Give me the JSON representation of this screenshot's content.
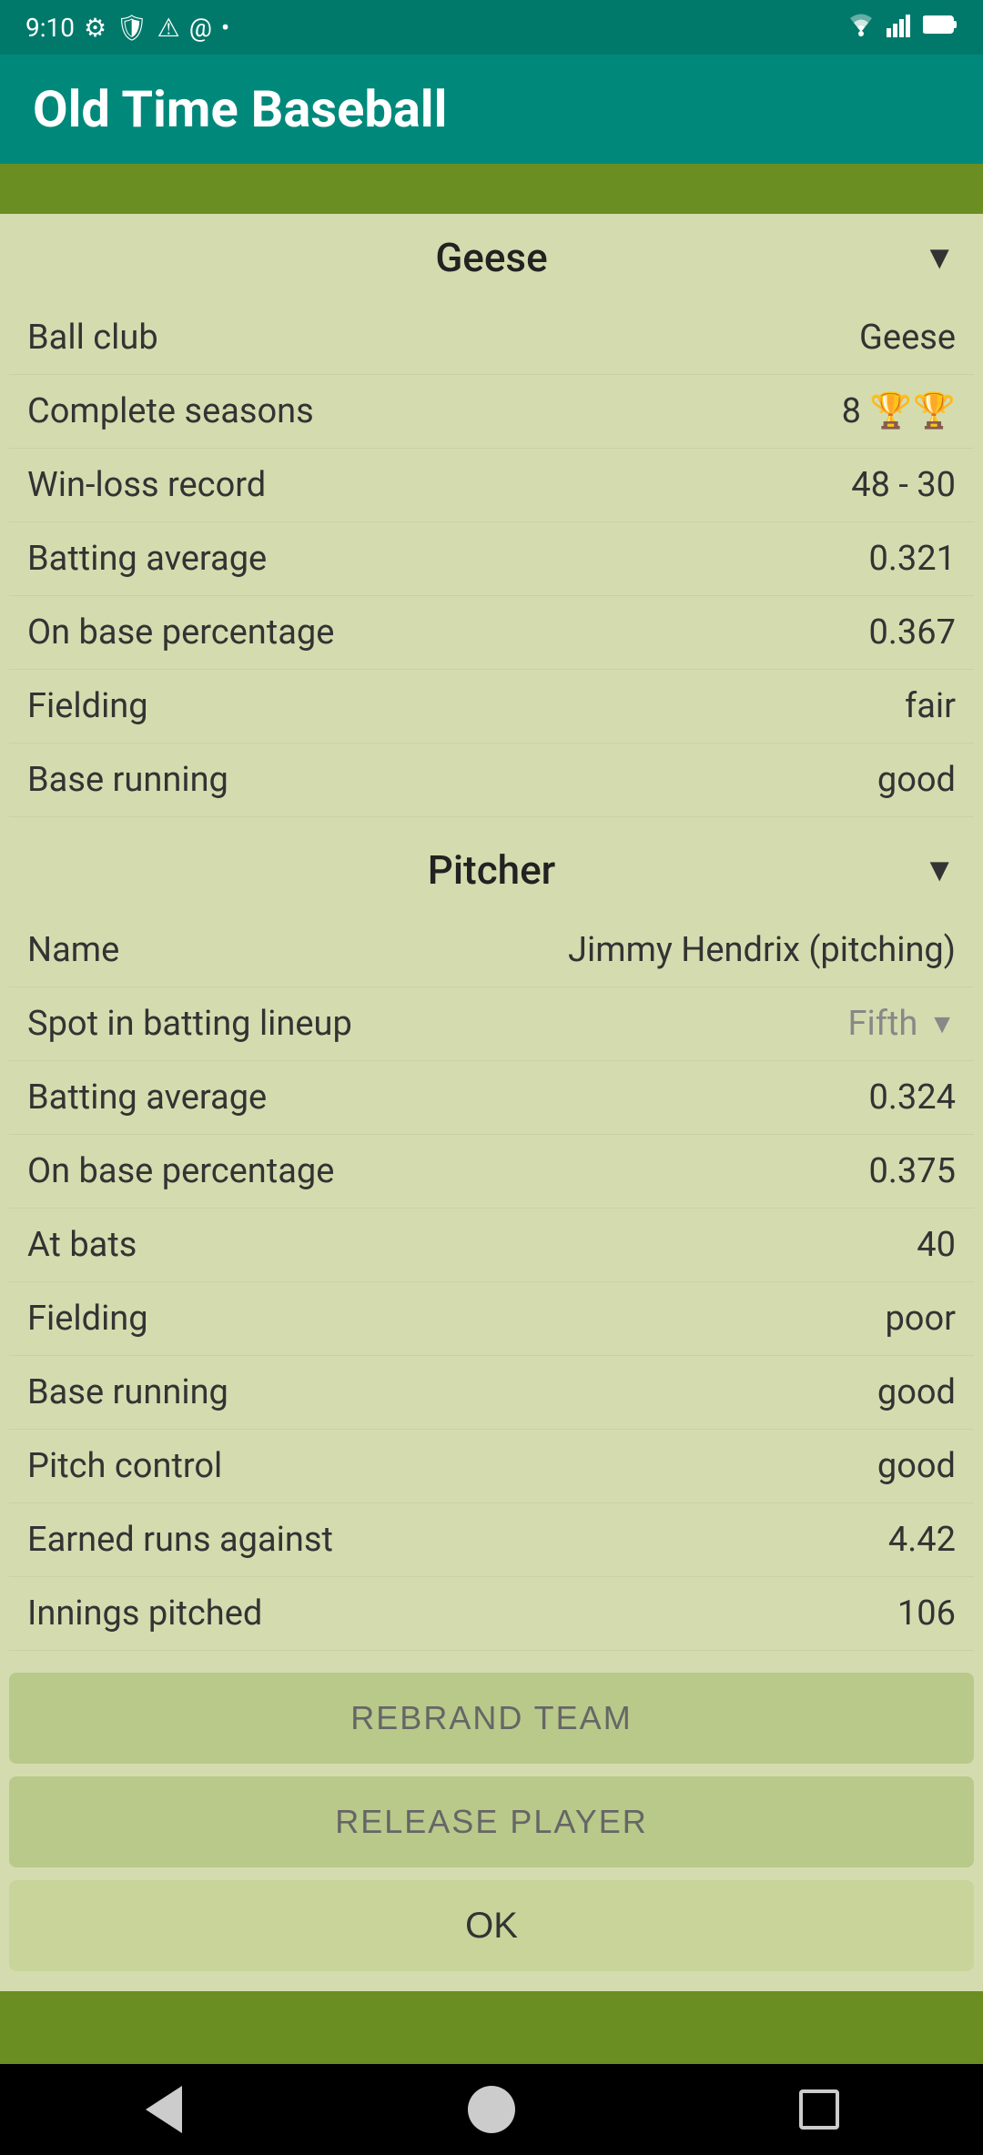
{
  "statusBar": {
    "time": "9:10",
    "leftIcons": [
      "⚙",
      "🛡",
      "⚠",
      "@",
      "•"
    ],
    "rightIcons": [
      "wifi",
      "signal",
      "battery"
    ]
  },
  "appHeader": {
    "title": "Old Time Baseball"
  },
  "teamSection": {
    "sectionTitle": "Geese",
    "rows": [
      {
        "label": "Ball club",
        "value": "Geese"
      },
      {
        "label": "Complete seasons",
        "value": "8 🏆🏆"
      },
      {
        "label": "Win-loss record",
        "value": "48 - 30"
      },
      {
        "label": "Batting average",
        "value": "0.321"
      },
      {
        "label": "On base percentage",
        "value": "0.367"
      },
      {
        "label": "Fielding",
        "value": "fair"
      },
      {
        "label": "Base running",
        "value": "good"
      }
    ]
  },
  "pitcherSection": {
    "sectionTitle": "Pitcher",
    "rows": [
      {
        "label": "Name",
        "value": "Jimmy Hendrix (pitching)",
        "dropdown": false
      },
      {
        "label": "Spot in batting lineup",
        "value": "Fifth",
        "dropdown": true
      },
      {
        "label": "Batting average",
        "value": "0.324",
        "dropdown": false
      },
      {
        "label": "On base percentage",
        "value": "0.375",
        "dropdown": false
      },
      {
        "label": "At bats",
        "value": "40",
        "dropdown": false
      },
      {
        "label": "Fielding",
        "value": "poor",
        "dropdown": false
      },
      {
        "label": "Base running",
        "value": "good",
        "dropdown": false
      },
      {
        "label": "Pitch control",
        "value": "good",
        "dropdown": false
      },
      {
        "label": "Earned runs against",
        "value": "4.42",
        "dropdown": false
      },
      {
        "label": "Innings pitched",
        "value": "106",
        "dropdown": false
      }
    ]
  },
  "buttons": {
    "rebrand": "REBRAND TEAM",
    "release": "RELEASE PLAYER",
    "ok": "OK"
  },
  "nav": {
    "back": "back",
    "home": "home",
    "recents": "recents"
  }
}
